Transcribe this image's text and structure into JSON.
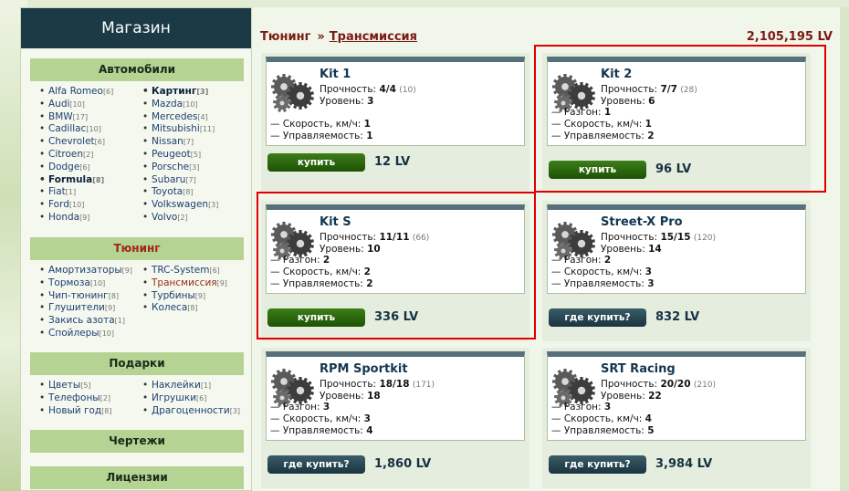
{
  "sidebar": {
    "title": "Магазин",
    "sections": [
      {
        "title": "Автомобили",
        "col1": [
          {
            "label": "Alfa Romeo",
            "count": "[6]"
          },
          {
            "label": "Audi",
            "count": "[10]"
          },
          {
            "label": "BMW",
            "count": "[17]"
          },
          {
            "label": "Cadillac",
            "count": "[10]"
          },
          {
            "label": "Chevrolet",
            "count": "[6]"
          },
          {
            "label": "Citroen",
            "count": "[2]"
          },
          {
            "label": "Dodge",
            "count": "[6]"
          },
          {
            "label": "Formula",
            "count": "[8]"
          },
          {
            "label": "Fiat",
            "count": "[1]"
          },
          {
            "label": "Ford",
            "count": "[10]"
          },
          {
            "label": "Honda",
            "count": "[9]"
          }
        ],
        "col2": [
          {
            "label": "Картинг",
            "count": "[3]"
          },
          {
            "label": "Mazda",
            "count": "[10]"
          },
          {
            "label": "Mercedes",
            "count": "[4]"
          },
          {
            "label": "Mitsubishi",
            "count": "[11]"
          },
          {
            "label": "Nissan",
            "count": "[7]"
          },
          {
            "label": "Peugeot",
            "count": "[5]"
          },
          {
            "label": "Porsche",
            "count": "[3]"
          },
          {
            "label": "Subaru",
            "count": "[7]"
          },
          {
            "label": "Toyota",
            "count": "[8]"
          },
          {
            "label": "Volkswagen",
            "count": "[3]"
          },
          {
            "label": "Volvo",
            "count": "[2]"
          }
        ]
      },
      {
        "title": "Тюнинг",
        "col1": [
          {
            "label": "Амортизаторы",
            "count": "[9]"
          },
          {
            "label": "Тормоза",
            "count": "[10]"
          },
          {
            "label": "Чип-тюнинг",
            "count": "[8]"
          },
          {
            "label": "Глушители",
            "count": "[9]"
          },
          {
            "label": "Закись азота",
            "count": "[1]"
          },
          {
            "label": "Спойлеры",
            "count": "[10]"
          }
        ],
        "col2": [
          {
            "label": "TRC-System",
            "count": "[6]"
          },
          {
            "label": "Трансмиссия",
            "count": "[9]"
          },
          {
            "label": "Турбины",
            "count": "[9]"
          },
          {
            "label": "Колеса",
            "count": "[8]"
          }
        ]
      },
      {
        "title": "Подарки",
        "col1": [
          {
            "label": "Цветы",
            "count": "[5]"
          },
          {
            "label": "Телефоны",
            "count": "[2]"
          },
          {
            "label": "Новый год",
            "count": "[8]"
          }
        ],
        "col2": [
          {
            "label": "Наклейки",
            "count": "[1]"
          },
          {
            "label": "Игрушки",
            "count": "[6]"
          },
          {
            "label": "Драгоценности",
            "count": "[3]"
          }
        ]
      },
      {
        "title": "Чертежи"
      },
      {
        "title": "Лицензии"
      }
    ]
  },
  "header": {
    "crumb_root": "Тюнинг",
    "crumb_sep": "»",
    "crumb_current": "Трансмиссия",
    "balance": "2,105,195 LV"
  },
  "labels": {
    "strength": "Прочность:",
    "level": "Уровень:",
    "buy": "купить",
    "where_buy": "где купить?"
  },
  "products": [
    {
      "name": "Kit 1",
      "strength": "4/4",
      "strength_max": "(10)",
      "level": "3",
      "bonuses": [
        {
          "label": "— Скорость, км/ч:",
          "value": "1"
        },
        {
          "label": "— Управляемость:",
          "value": "1"
        }
      ],
      "button": "купить",
      "price": "12 LV"
    },
    {
      "name": "Kit 2",
      "strength": "7/7",
      "strength_max": "(28)",
      "level": "6",
      "bonuses": [
        {
          "label": "— Разгон:",
          "value": "1"
        },
        {
          "label": "— Скорость, км/ч:",
          "value": "1"
        },
        {
          "label": "— Управляемость:",
          "value": "2"
        }
      ],
      "button": "купить",
      "price": "96 LV"
    },
    {
      "name": "Kit S",
      "strength": "11/11",
      "strength_max": "(66)",
      "level": "10",
      "bonuses": [
        {
          "label": "— Разгон:",
          "value": "2"
        },
        {
          "label": "— Скорость, км/ч:",
          "value": "2"
        },
        {
          "label": "— Управляемость:",
          "value": "2"
        }
      ],
      "button": "купить",
      "price": "336 LV"
    },
    {
      "name": "Street-X Pro",
      "strength": "15/15",
      "strength_max": "(120)",
      "level": "14",
      "bonuses": [
        {
          "label": "— Разгон:",
          "value": "2"
        },
        {
          "label": "— Скорость, км/ч:",
          "value": "3"
        },
        {
          "label": "— Управляемость:",
          "value": "3"
        }
      ],
      "button": "где купить?",
      "price": "832 LV"
    },
    {
      "name": "RPM Sportkit",
      "strength": "18/18",
      "strength_max": "(171)",
      "level": "18",
      "bonuses": [
        {
          "label": "— Разгон:",
          "value": "3"
        },
        {
          "label": "— Скорость, км/ч:",
          "value": "3"
        },
        {
          "label": "— Управляемость:",
          "value": "4"
        }
      ],
      "button": "где купить?",
      "price": "1,860 LV"
    },
    {
      "name": "SRT Racing",
      "strength": "20/20",
      "strength_max": "(210)",
      "level": "22",
      "bonuses": [
        {
          "label": "— Разгон:",
          "value": "3"
        },
        {
          "label": "— Скорость, км/ч:",
          "value": "4"
        },
        {
          "label": "— Управляемость:",
          "value": "5"
        }
      ],
      "button": "где купить?",
      "price": "3,984 LV"
    }
  ]
}
